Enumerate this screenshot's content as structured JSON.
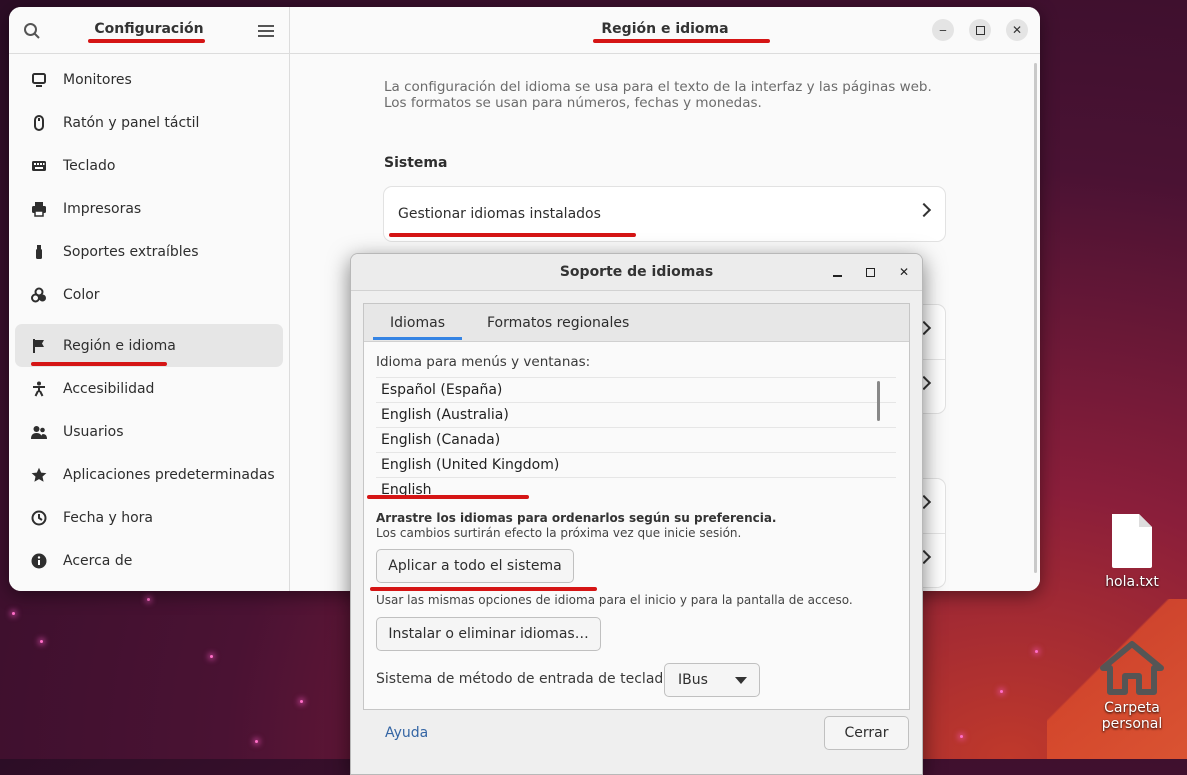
{
  "settings": {
    "sidebar_title": "Configuración",
    "items": [
      {
        "label": "Monitores",
        "icon": "monitor-icon"
      },
      {
        "label": "Ratón y panel táctil",
        "icon": "mouse-icon"
      },
      {
        "label": "Teclado",
        "icon": "keyboard-icon"
      },
      {
        "label": "Impresoras",
        "icon": "printer-icon"
      },
      {
        "label": "Soportes extraíbles",
        "icon": "usb-icon"
      },
      {
        "label": "Color",
        "icon": "color-icon"
      },
      {
        "label": "Región e idioma",
        "icon": "flag-icon",
        "active": true
      },
      {
        "label": "Accesibilidad",
        "icon": "accessibility-icon"
      },
      {
        "label": "Usuarios",
        "icon": "users-icon"
      },
      {
        "label": "Aplicaciones predeterminadas",
        "icon": "star-icon"
      },
      {
        "label": "Fecha y hora",
        "icon": "clock-icon"
      },
      {
        "label": "Acerca de",
        "icon": "info-icon"
      }
    ],
    "main_title": "Región e idioma",
    "description": "La configuración del idioma se usa para el texto de la interfaz y las páginas web. Los formatos se usan para números, fechas y monedas.",
    "section_title": "Sistema",
    "manage_languages": "Gestionar idiomas instalados"
  },
  "dialog": {
    "title": "Soporte de idiomas",
    "tabs": [
      "Idiomas",
      "Formatos regionales"
    ],
    "list_label": "Idioma para menús y ventanas:",
    "languages": [
      "Español (España)",
      "English (Australia)",
      "English (Canada)",
      "English (United Kingdom)",
      "English"
    ],
    "drag_hint": "Arrastre los idiomas para ordenarlos según su preferencia.",
    "restart_hint": "Los cambios surtirán efecto la próxima vez que inicie sesión.",
    "apply_button": "Aplicar a todo el sistema",
    "apply_hint": "Usar las mismas opciones de idioma para el inicio y para la pantalla de acceso.",
    "install_button": "Instalar o eliminar idiomas…",
    "input_method_label": "Sistema de método de entrada de teclado:",
    "input_method_value": "IBus",
    "help_link": "Ayuda",
    "close_button": "Cerrar"
  },
  "desktop": {
    "file_label": "hola.txt",
    "home_label": "Carpeta personal"
  },
  "colors": {
    "annotation": "#d51515",
    "accent": "#3584e4",
    "link": "#3465a4"
  }
}
